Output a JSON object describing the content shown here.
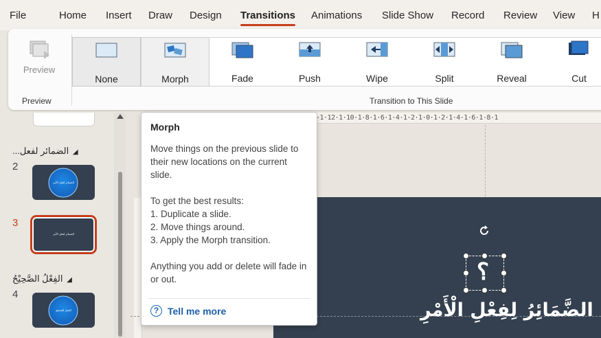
{
  "menu": {
    "tabs": [
      "File",
      "Home",
      "Insert",
      "Draw",
      "Design",
      "Transitions",
      "Animations",
      "Slide Show",
      "Record",
      "Review",
      "View",
      "H"
    ],
    "active": "Transitions"
  },
  "ribbon": {
    "preview": {
      "label": "Preview"
    },
    "gallery": [
      {
        "label": "None",
        "icon": "none-transition-icon",
        "selected": true
      },
      {
        "label": "Morph",
        "icon": "morph-transition-icon",
        "selected": false
      },
      {
        "label": "Fade",
        "icon": "fade-transition-icon",
        "selected": false
      },
      {
        "label": "Push",
        "icon": "push-transition-icon",
        "selected": false
      },
      {
        "label": "Wipe",
        "icon": "wipe-transition-icon",
        "selected": false
      },
      {
        "label": "Split",
        "icon": "split-transition-icon",
        "selected": false
      },
      {
        "label": "Reveal",
        "icon": "reveal-transition-icon",
        "selected": false
      },
      {
        "label": "Cut",
        "icon": "cut-transition-icon",
        "selected": false
      }
    ],
    "groups": {
      "preview": "Preview",
      "transition": "Transition to This Slide"
    }
  },
  "left_panel": {
    "sections": [
      {
        "title": "الضمائر لفعل..."
      },
      {
        "title": "الفِعْلُ الصَّحِيْحُ"
      }
    ],
    "slides": [
      {
        "number": "2",
        "caption": "الضمائر لفعل الأمر"
      },
      {
        "number": "3",
        "caption": "الضمائر لفعل الأمر"
      },
      {
        "number": "4",
        "caption": "الفعل الصحيح"
      }
    ]
  },
  "ruler": {
    "text": "·1·12·1·10·1·8·1·6·1·4·1·2·1·0·1·2·1·4·1·6·1·8·1"
  },
  "slide": {
    "title": "الضَّمَائِرُ لِفِعْلِ الْأَمْرِ",
    "symbol": "؟"
  },
  "tooltip": {
    "title": "Morph",
    "paragraphs": [
      "Move things on the previous slide to their new locations on the current slide.",
      "To get the best results:",
      "1. Duplicate a slide.",
      "2. Move things around.",
      "3. Apply the Morph transition.",
      "Anything you add or delete will fade in or out."
    ],
    "link": "Tell me more"
  },
  "colors": {
    "accent": "#c43e1c",
    "slide_bg": "#34404f",
    "link": "#1d5fa8"
  }
}
